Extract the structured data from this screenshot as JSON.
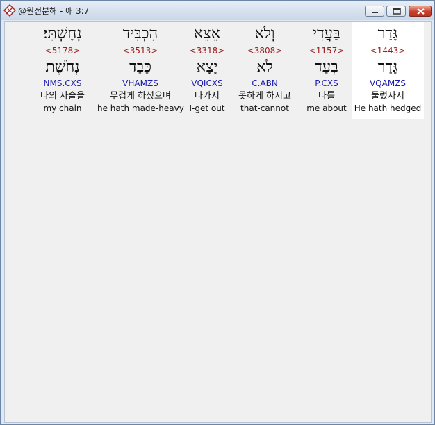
{
  "window": {
    "title": "@원전분해 - 애 3:7",
    "icon": "compass-pencil-icon",
    "controls": {
      "minimize": "minimize-icon",
      "maximize": "maximize-icon",
      "close": "close-icon"
    }
  },
  "words": [
    {
      "hebrew": "גָּדַר",
      "strong": "<1443>",
      "lemma": "גָּדַר",
      "parse": "VQAMZS",
      "korean": "둘렀사서",
      "english": "He hath hedged",
      "selected": true
    },
    {
      "hebrew": "בַּעֲדִי",
      "strong": "<1157>",
      "lemma": "בְּעַד",
      "parse": "P.CXS",
      "korean": "나를",
      "english": "me about",
      "selected": false
    },
    {
      "hebrew": "וְלֹא",
      "strong": "<3808>",
      "lemma": "לֹא",
      "parse": "C.ABN",
      "korean": "못하게 하시고",
      "english": "that-cannot",
      "selected": false
    },
    {
      "hebrew": "אֵצֵא",
      "strong": "<3318>",
      "lemma": "יָצָא",
      "parse": "VQICXS",
      "korean": "나가지",
      "english": "I-get out",
      "selected": false
    },
    {
      "hebrew": "הִכְבִּיד",
      "strong": "<3513>",
      "lemma": "כָּבַד",
      "parse": "VHAMZS",
      "korean": "무겁게 하셨으며",
      "english": "he hath made-heavy",
      "selected": false
    },
    {
      "hebrew": "נְחָשְׁתִּי׃",
      "strong": "<5178>",
      "lemma": "נְחֹשֶׁת",
      "parse": "NMS.CXS",
      "korean": "나의 사슬을",
      "english": "my chain",
      "selected": false
    }
  ]
}
